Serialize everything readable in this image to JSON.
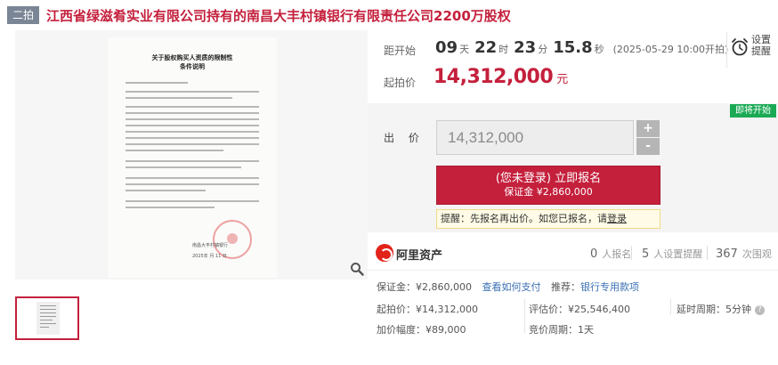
{
  "header": {
    "round_badge": "二拍",
    "title": "江西省绿滋肴实业有限公司持有的南昌大丰村镇银行有限责任公司2200万股权"
  },
  "gallery": {
    "doc_title_line1": "关于股权购买人资质的限制性",
    "doc_title_line2": "条件说明",
    "doc_sign": "南昌大丰村镇银行",
    "doc_date": "2025年 月 11 日",
    "zoom_icon": "magnifier-icon"
  },
  "countdown": {
    "label": "距开始",
    "days": "09",
    "days_unit": "天",
    "hours": "22",
    "hours_unit": "时",
    "minutes": "23",
    "minutes_unit": "分",
    "seconds": "15.8",
    "seconds_unit": "秒",
    "start_time": "(2025-05-29 10:00开拍)"
  },
  "remind": {
    "icon": "alarm-clock-icon",
    "label": "设置提醒"
  },
  "start_price": {
    "label": "起拍价",
    "value": "14,312,000",
    "unit": "元"
  },
  "bid": {
    "status_badge": "即将开始",
    "label": "出 价",
    "input_value": "14,312,000",
    "plus": "+",
    "minus": "-",
    "apply_main": "(您未登录) 立即报名",
    "apply_sub": "保证金 ¥2,860,000",
    "tip_text": "提醒：先报名再出价。如您已报名，请",
    "tip_link": "登录"
  },
  "platform": {
    "name": "阿里资产",
    "stats": [
      {
        "num": "0",
        "label": "人报名"
      },
      {
        "num": "5",
        "label": "人设置提醒"
      },
      {
        "num": "367",
        "label": "次围观"
      }
    ]
  },
  "details": {
    "deposit_label": "保证金：",
    "deposit_value": "¥2,860,000",
    "deposit_link": "查看如何支付",
    "recommend_label": "推荐：",
    "recommend_value": "银行专用款项",
    "start_price_label": "起拍价：",
    "start_price_value": "¥14,312,000",
    "appraisal_label": "评估价：",
    "appraisal_value": "¥25,546,400",
    "delay_label": "延时周期：",
    "delay_value": "5分钟",
    "increment_label": "加价幅度：",
    "increment_value": "¥89,000",
    "cycle_label": "竞价周期：",
    "cycle_value": "1天"
  },
  "colors": {
    "accent": "#c4203c",
    "badge_green": "#1aaa55",
    "link_blue": "#3a6fb4"
  }
}
